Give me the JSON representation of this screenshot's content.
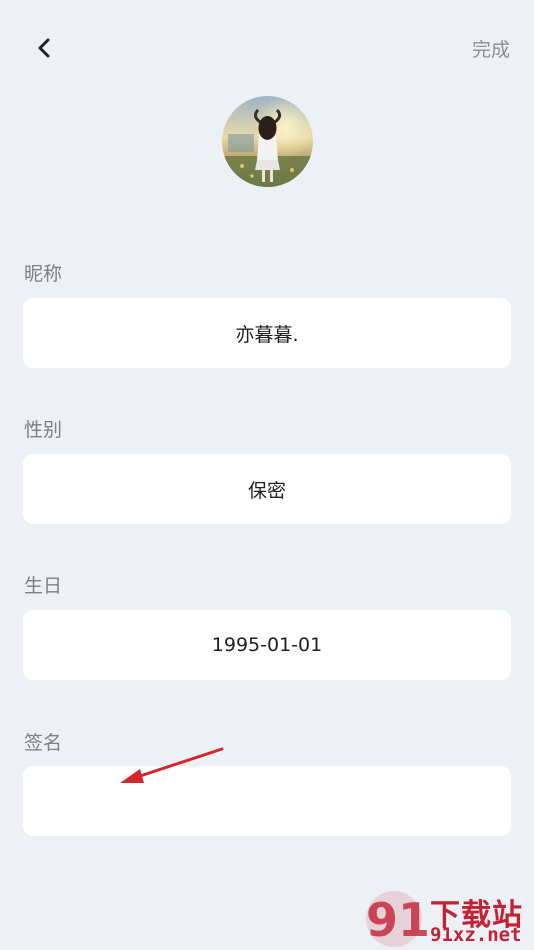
{
  "header": {
    "back_icon": "chevron-left-icon",
    "done_label": "完成"
  },
  "profile": {
    "avatar_icon": "avatar-photo"
  },
  "fields": {
    "nickname": {
      "label": "昵称",
      "value": "亦暮暮."
    },
    "gender": {
      "label": "性别",
      "value": "保密"
    },
    "birthday": {
      "label": "生日",
      "value": "1995-01-01"
    },
    "signature": {
      "label": "签名",
      "value": ""
    }
  },
  "watermark": {
    "logo_text": "91",
    "brand_text": "下载站",
    "url_text": "91xz.net"
  },
  "colors": {
    "background": "#edf1f5",
    "field_bg": "#ffffff",
    "label": "#7c7f84",
    "accent_red": "#c32235"
  }
}
